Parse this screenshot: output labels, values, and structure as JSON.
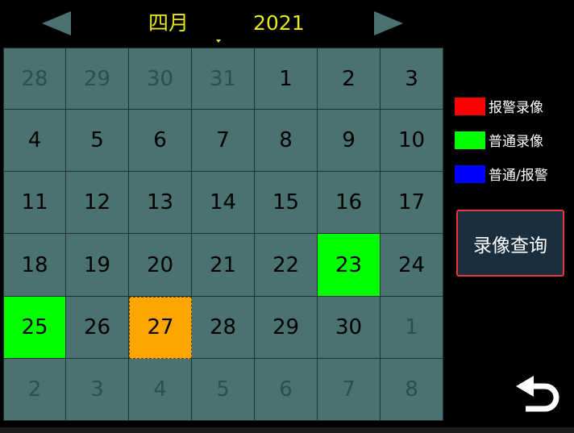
{
  "header": {
    "prev_icon": "triangle-left",
    "next_icon": "triangle-right",
    "month": "四月",
    "year": "2021"
  },
  "calendar": {
    "rows": [
      [
        {
          "d": "28",
          "s": "other"
        },
        {
          "d": "29",
          "s": "other"
        },
        {
          "d": "30",
          "s": "other"
        },
        {
          "d": "31",
          "s": "other"
        },
        {
          "d": "1",
          "s": ""
        },
        {
          "d": "2",
          "s": ""
        },
        {
          "d": "3",
          "s": ""
        }
      ],
      [
        {
          "d": "4",
          "s": ""
        },
        {
          "d": "5",
          "s": ""
        },
        {
          "d": "6",
          "s": ""
        },
        {
          "d": "7",
          "s": ""
        },
        {
          "d": "8",
          "s": ""
        },
        {
          "d": "9",
          "s": ""
        },
        {
          "d": "10",
          "s": ""
        }
      ],
      [
        {
          "d": "11",
          "s": ""
        },
        {
          "d": "12",
          "s": ""
        },
        {
          "d": "13",
          "s": ""
        },
        {
          "d": "14",
          "s": ""
        },
        {
          "d": "15",
          "s": ""
        },
        {
          "d": "16",
          "s": ""
        },
        {
          "d": "17",
          "s": ""
        }
      ],
      [
        {
          "d": "18",
          "s": ""
        },
        {
          "d": "19",
          "s": ""
        },
        {
          "d": "20",
          "s": ""
        },
        {
          "d": "21",
          "s": ""
        },
        {
          "d": "22",
          "s": ""
        },
        {
          "d": "23",
          "s": "normal"
        },
        {
          "d": "24",
          "s": ""
        }
      ],
      [
        {
          "d": "25",
          "s": "normal"
        },
        {
          "d": "26",
          "s": ""
        },
        {
          "d": "27",
          "s": "selected"
        },
        {
          "d": "28",
          "s": ""
        },
        {
          "d": "29",
          "s": ""
        },
        {
          "d": "30",
          "s": ""
        },
        {
          "d": "1",
          "s": "other"
        }
      ],
      [
        {
          "d": "2",
          "s": "other"
        },
        {
          "d": "3",
          "s": "other"
        },
        {
          "d": "4",
          "s": "other"
        },
        {
          "d": "5",
          "s": "other"
        },
        {
          "d": "6",
          "s": "other"
        },
        {
          "d": "7",
          "s": "other"
        },
        {
          "d": "8",
          "s": "other"
        }
      ]
    ]
  },
  "legend": [
    {
      "label": "报警录像",
      "color": "#ff0000"
    },
    {
      "label": "普通录像",
      "color": "#00ff00"
    },
    {
      "label": "普通/报警",
      "color": "#0000ff"
    }
  ],
  "query_button": {
    "label": "录像查询"
  },
  "back_icon": "return-arrow",
  "colors": {
    "accent_text": "#e6e619",
    "grid": "#4a7270",
    "selected": "#ffa500",
    "button_border": "#e8343a"
  }
}
